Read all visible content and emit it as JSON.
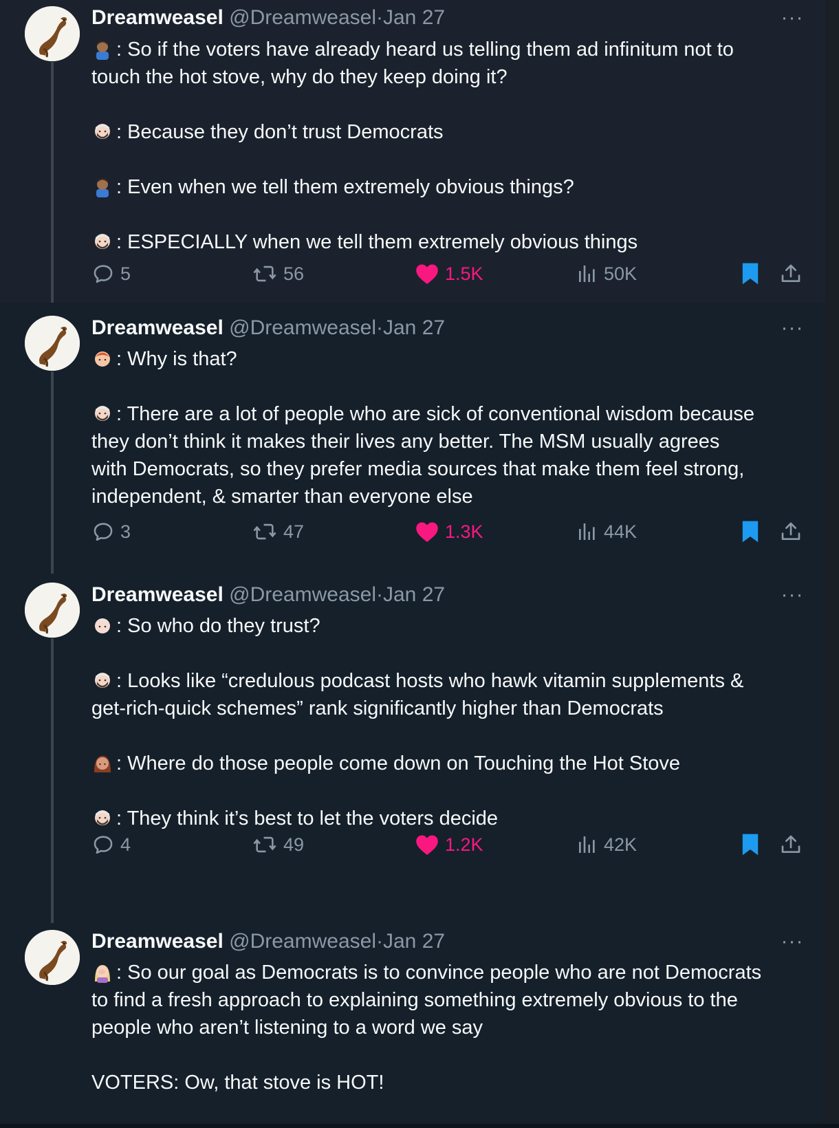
{
  "tweets": [
    {
      "author": "Dreamweasel",
      "handle": "@Dreamweasel",
      "sep": "·",
      "date": "Jan 27",
      "more_label": "···",
      "lines": [
        {
          "emoji": "man-medium-skin",
          "text": ": So if the voters have already heard us telling them ad infinitum not to"
        },
        {
          "emoji": "",
          "text": "touch the hot stove, why do they keep doing it?"
        },
        {
          "emoji": "",
          "text": ""
        },
        {
          "emoji": "bearded-person",
          "text": ": Because they don’t trust Democrats"
        },
        {
          "emoji": "",
          "text": ""
        },
        {
          "emoji": "man-medium-skin",
          "text": ": Even when we tell them extremely obvious things?"
        },
        {
          "emoji": "",
          "text": ""
        },
        {
          "emoji": "bearded-person",
          "text": ": ESPECIALLY when we tell them extremely obvious things"
        }
      ],
      "replies": "5",
      "reposts": "56",
      "likes": "1.5K",
      "views": "50K"
    },
    {
      "author": "Dreamweasel",
      "handle": "@Dreamweasel",
      "sep": "·",
      "date": "Jan 27",
      "more_label": "···",
      "lines": [
        {
          "emoji": "red-haired-person",
          "text": ": Why is that?"
        },
        {
          "emoji": "",
          "text": ""
        },
        {
          "emoji": "bearded-person",
          "text": ": There are a lot of people who are sick of conventional wisdom because"
        },
        {
          "emoji": "",
          "text": "they don’t think it makes their lives any better. The MSM usually agrees"
        },
        {
          "emoji": "",
          "text": "with Democrats, so they prefer media sources that make them feel strong,"
        },
        {
          "emoji": "",
          "text": "independent, & smarter than everyone else"
        }
      ],
      "replies": "3",
      "reposts": "47",
      "likes": "1.3K",
      "views": "44K"
    },
    {
      "author": "Dreamweasel",
      "handle": "@Dreamweasel",
      "sep": "·",
      "date": "Jan 27",
      "more_label": "···",
      "lines": [
        {
          "emoji": "older-person",
          "text": ": So who do they trust?"
        },
        {
          "emoji": "",
          "text": ""
        },
        {
          "emoji": "bearded-person",
          "text": ": Looks like “credulous podcast hosts who hawk vitamin supplements &"
        },
        {
          "emoji": "",
          "text": "get-rich-quick schemes” rank significantly higher than Democrats"
        },
        {
          "emoji": "",
          "text": ""
        },
        {
          "emoji": "woman-auburn-hair",
          "text": ": Where do those people come down on Touching the Hot Stove"
        },
        {
          "emoji": "",
          "text": ""
        },
        {
          "emoji": "bearded-person",
          "text": ": They think it’s best to let the voters decide"
        }
      ],
      "replies": "4",
      "reposts": "49",
      "likes": "1.2K",
      "views": "42K"
    },
    {
      "author": "Dreamweasel",
      "handle": "@Dreamweasel",
      "sep": "·",
      "date": "Jan 27",
      "more_label": "···",
      "lines": [
        {
          "emoji": "woman-facepalming",
          "text": ": So our goal as Democrats is to convince people who are not Democrats"
        },
        {
          "emoji": "",
          "text": "to find a fresh approach to explaining something extremely obvious to the"
        },
        {
          "emoji": "",
          "text": "people who aren’t listening to a word we say"
        },
        {
          "emoji": "",
          "text": ""
        },
        {
          "emoji": "",
          "text": "VOTERS: Ow, that stove is HOT!"
        }
      ]
    }
  ],
  "colors": {
    "background": "#15202b",
    "highlight_background": "#1b222d",
    "text": "#f7f9f9",
    "secondary": "#8b98a5",
    "like": "#f91880",
    "bookmark": "#1d9bf0"
  }
}
